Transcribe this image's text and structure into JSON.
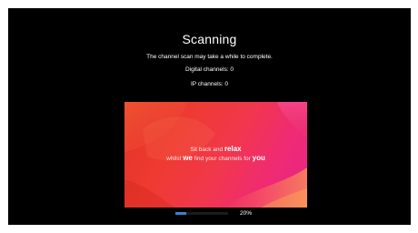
{
  "scan": {
    "title": "Scanning",
    "subtitle": "The channel scan may take a while to complete.",
    "digital_channels": "Digital channels: 0",
    "ip_channels": "IP channels: 0"
  },
  "banner": {
    "line1_part1": "Sit back and ",
    "line1_bold": "relax",
    "line2_part1": "whilst ",
    "line2_bold1": "we",
    "line2_part2": " find your channels for ",
    "line2_bold2": "you"
  },
  "progress": {
    "value": 0.2,
    "label": "20%"
  },
  "colors": {
    "background": "#000000",
    "progress_fill": "#3f7fd6",
    "banner_start": "#e23425",
    "banner_end": "#e6248a"
  }
}
